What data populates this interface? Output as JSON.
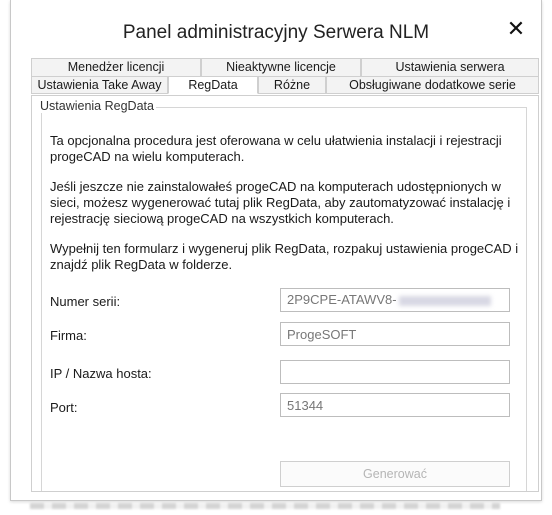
{
  "window": {
    "title": "Panel administracyjny Serwera NLM",
    "close_glyph": "✕"
  },
  "tabs": {
    "top": [
      {
        "label": "Menedżer licencji"
      },
      {
        "label": "Nieaktywne licencje"
      },
      {
        "label": "Ustawienia serwera"
      }
    ],
    "bottom": [
      {
        "label": "Ustawienia Take Away"
      },
      {
        "label": "RegData",
        "active": true
      },
      {
        "label": "Różne"
      },
      {
        "label": "Obsługiwane dodatkowe serie"
      }
    ]
  },
  "regdata": {
    "group_label": "Ustawienia RegData",
    "paragraphs": [
      "Ta opcjonalna procedura jest oferowana w celu ułatwienia instalacji i rejestracji progeCAD na wielu komputerach.",
      "Jeśli jeszcze nie zainstalowałeś progeCAD na komputerach udostępnionych w sieci, możesz wygenerować tutaj plik RegData, aby zautomatyzować instalację i rejestrację sieciową progeCAD na wszystkich komputerach.",
      "Wypełnij ten formularz i wygeneruj plik RegData, rozpakuj ustawienia progeCAD i znajdź plik RegData w folderze."
    ],
    "fields": {
      "serial": {
        "label": "Numer serii:",
        "value": "2P9CPE-ATAWV8-"
      },
      "company": {
        "label": "Firma:",
        "value": "ProgeSOFT"
      },
      "host": {
        "label": "IP / Nazwa hosta:",
        "value": ""
      },
      "port": {
        "label": "Port:",
        "value": "51344"
      }
    },
    "generate_button": "Generować"
  },
  "colors": {
    "border": "#cfcfcf",
    "tab_inactive_bg": "#f3f3f3",
    "disabled_text": "#b5b5b5"
  }
}
